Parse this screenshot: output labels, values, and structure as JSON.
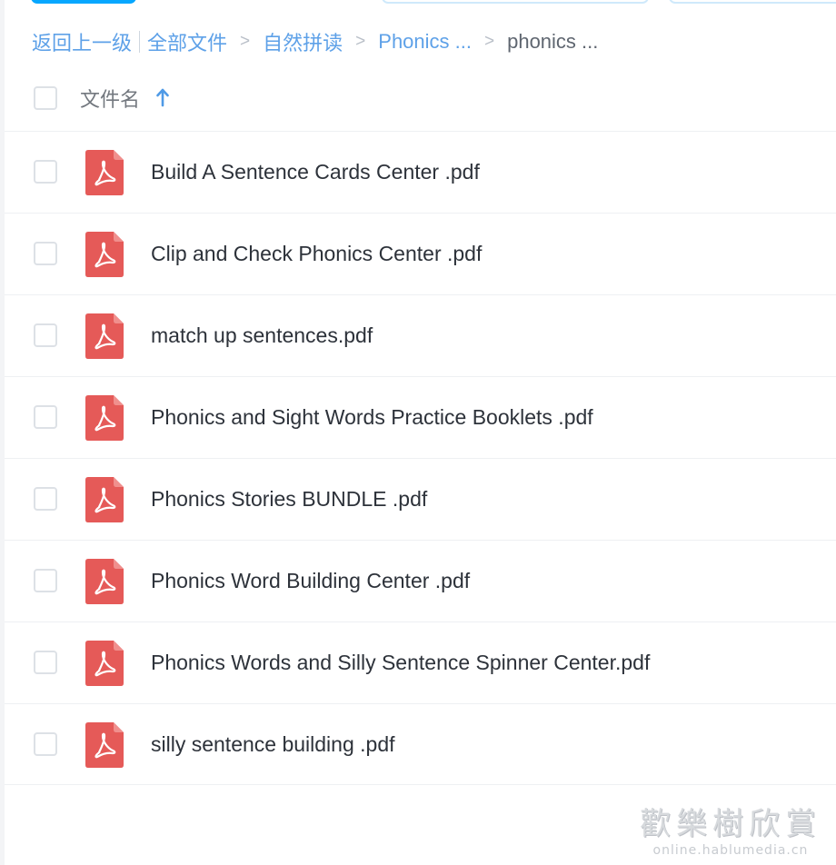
{
  "breadcrumb": {
    "back_label": "返回上一级",
    "items": [
      "全部文件",
      "自然拼读",
      "Phonics ...",
      "phonics ..."
    ]
  },
  "list_header": {
    "column_label": "文件名",
    "sort_icon": "arrow-up-icon"
  },
  "files": [
    {
      "name": "Build A Sentence Cards Center .pdf",
      "icon": "pdf-file-icon"
    },
    {
      "name": "Clip and Check Phonics Center .pdf",
      "icon": "pdf-file-icon"
    },
    {
      "name": "match up sentences.pdf",
      "icon": "pdf-file-icon"
    },
    {
      "name": "Phonics and Sight Words Practice Booklets .pdf",
      "icon": "pdf-file-icon"
    },
    {
      "name": "Phonics Stories BUNDLE .pdf",
      "icon": "pdf-file-icon"
    },
    {
      "name": "Phonics Word Building Center .pdf",
      "icon": "pdf-file-icon"
    },
    {
      "name": "Phonics Words and Silly Sentence Spinner Center.pdf",
      "icon": "pdf-file-icon"
    },
    {
      "name": "silly sentence building .pdf",
      "icon": "pdf-file-icon"
    }
  ],
  "watermark": {
    "main": "歡樂樹欣賞",
    "sub": "online.hablumedia.cn"
  },
  "colors": {
    "link": "#5ea1e8",
    "pdf_red": "#e55a58",
    "primary_button": "#06a7ff",
    "text": "#2d323a"
  }
}
